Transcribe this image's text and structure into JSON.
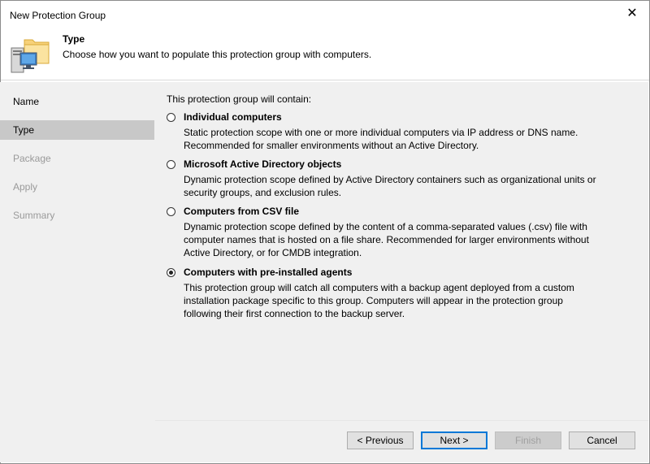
{
  "window": {
    "title": "New Protection Group",
    "close_glyph": "✕"
  },
  "header": {
    "title": "Type",
    "description": "Choose how you want to populate this protection group with computers.",
    "icon": "folder-computer-icon"
  },
  "sidebar": {
    "items": [
      {
        "label": "Name",
        "state": "done"
      },
      {
        "label": "Type",
        "state": "active"
      },
      {
        "label": "Package",
        "state": "pending"
      },
      {
        "label": "Apply",
        "state": "pending"
      },
      {
        "label": "Summary",
        "state": "pending"
      }
    ]
  },
  "main": {
    "intro": "This protection group will contain:",
    "options": [
      {
        "label": "Individual computers",
        "selected": false,
        "desc": [
          "Static protection scope with one or more individual computers via IP address or DNS name.",
          "Recommended for smaller environments without an Active Directory."
        ]
      },
      {
        "label": "Microsoft Active Directory objects",
        "selected": false,
        "desc": [
          "Dynamic protection scope defined by Active Directory containers such as organizational units or",
          "security groups, and exclusion rules."
        ]
      },
      {
        "label": "Computers from CSV file",
        "selected": false,
        "desc": [
          "Dynamic protection scope defined by the content of a comma-separated values (.csv) file with",
          "computer names that is hosted on a file share. Recommended for larger environments without",
          "Active Directory, or for CMDB integration."
        ]
      },
      {
        "label": "Computers with pre-installed agents",
        "selected": true,
        "desc": [
          "This protection group will catch all computers with a backup agent deployed from a custom",
          "installation package specific to this group.  Computers will appear in the protection group",
          "following their first connection to the backup server."
        ]
      }
    ]
  },
  "buttons": {
    "previous": "< Previous",
    "next": "Next >",
    "finish": "Finish",
    "cancel": "Cancel"
  },
  "colors": {
    "accent": "#0078d7",
    "panel": "#f0f0f0",
    "selected_nav": "#c8c8c8"
  }
}
